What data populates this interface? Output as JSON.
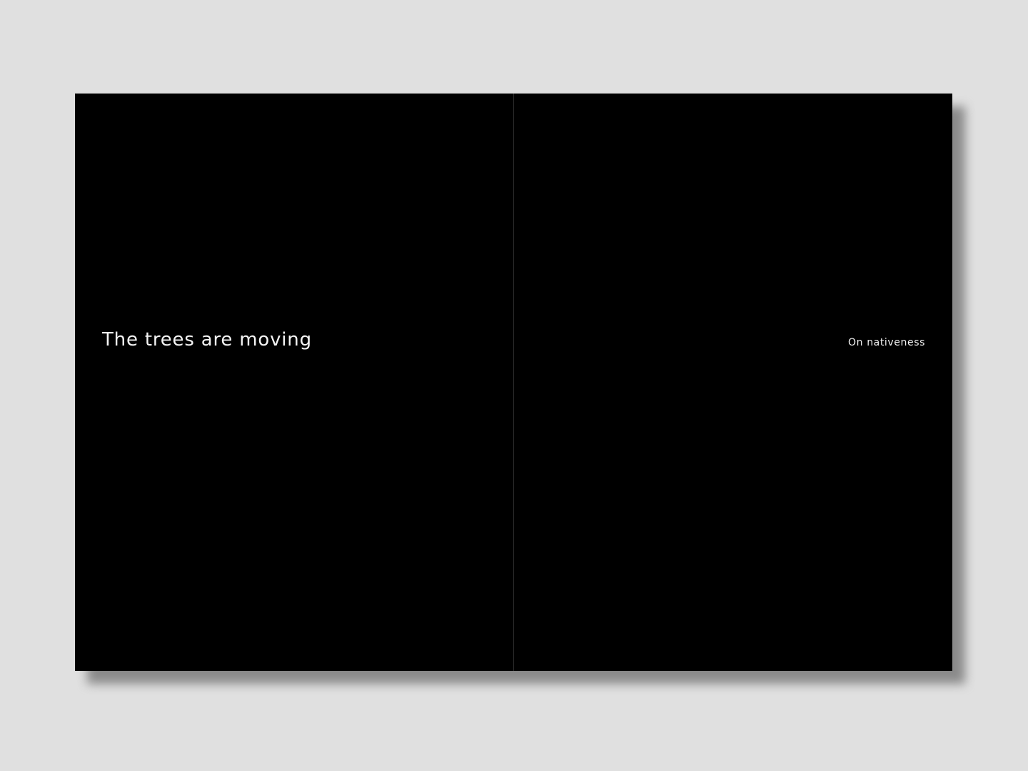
{
  "spread": {
    "left_page": {
      "title": "The trees are moving"
    },
    "right_page": {
      "title": "On nativeness"
    }
  },
  "colors": {
    "background": "#e0e0e0",
    "page": "#000000",
    "text": "#f4f4f4",
    "shadow": "#8a8a8a"
  }
}
